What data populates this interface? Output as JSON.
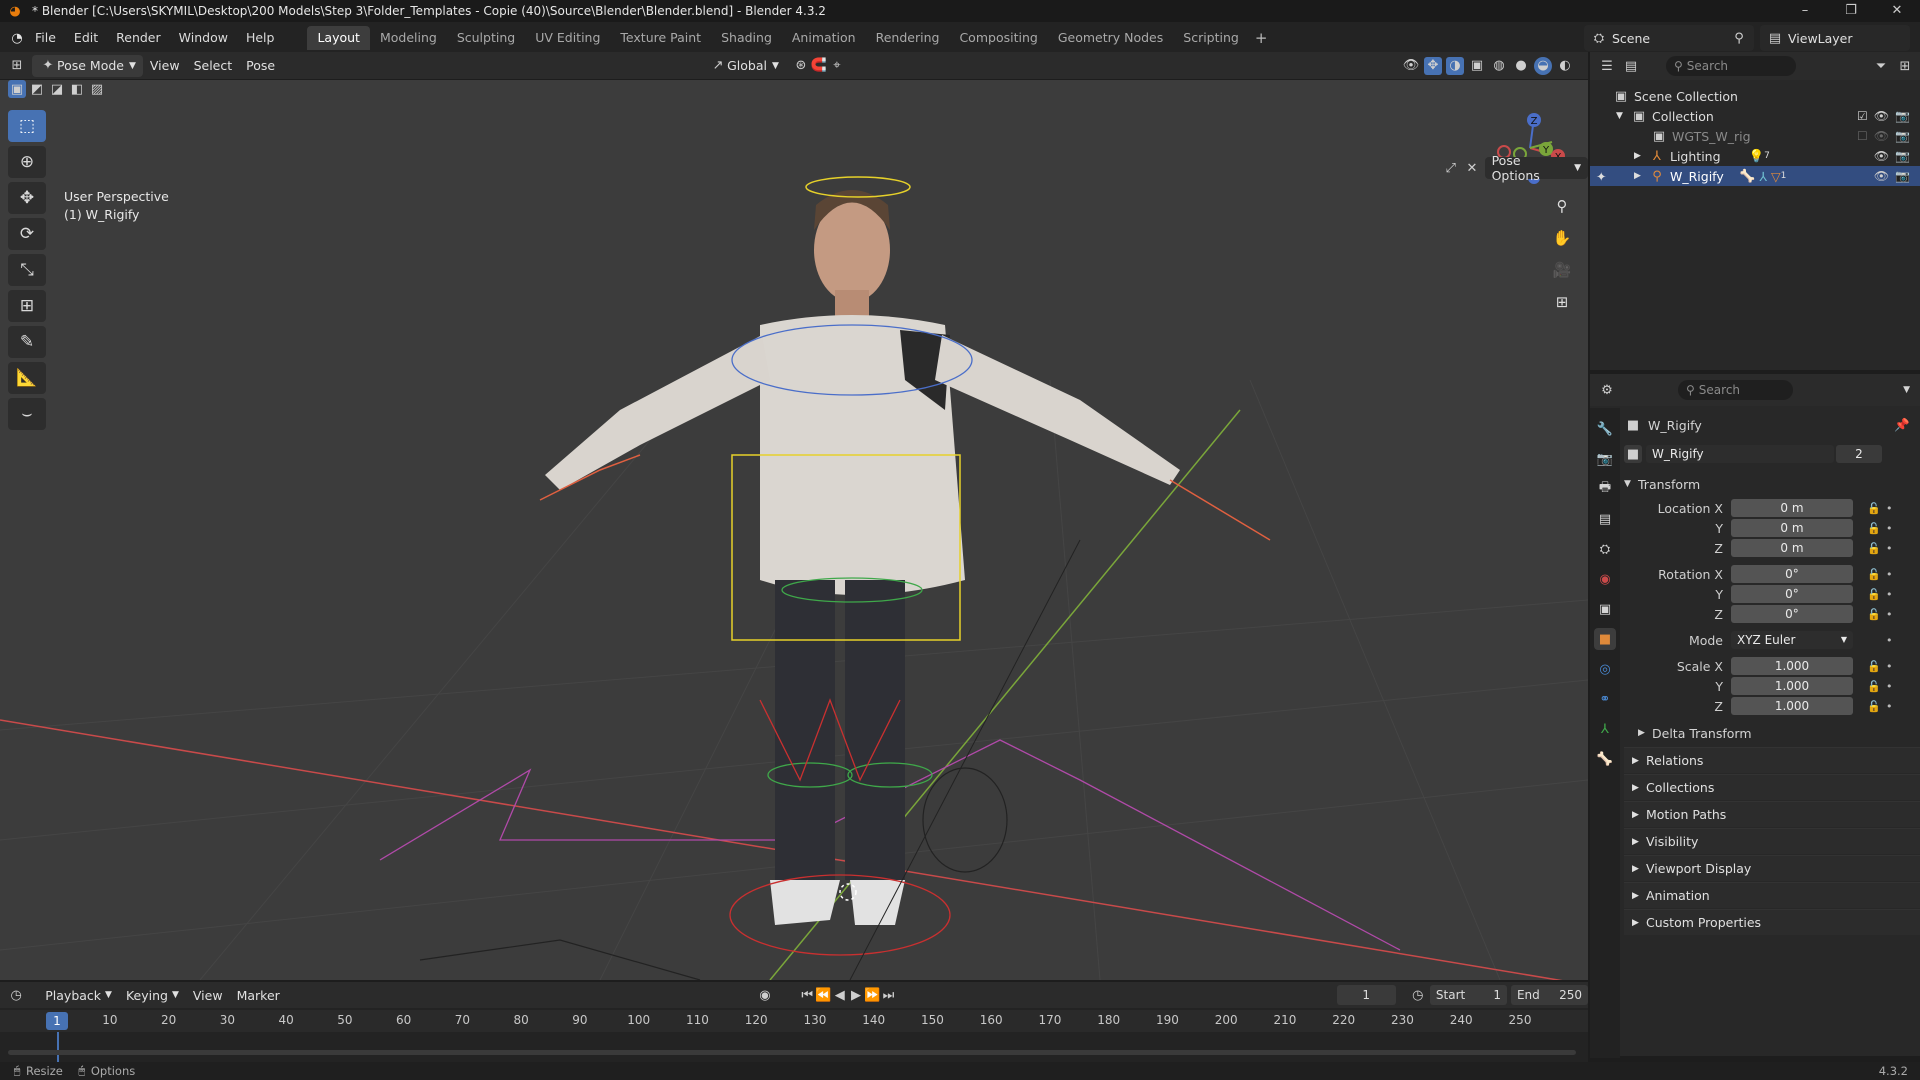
{
  "window": {
    "title": "* Blender [C:\\Users\\SKYMIL\\Desktop\\200 Models\\Step 3\\Folder_Templates - Copie (40)\\Source\\Blender\\Blender.blend] - Blender 4.3.2",
    "minimize": "–",
    "maximize": "❐",
    "close": "✕"
  },
  "menu": [
    "File",
    "Edit",
    "Render",
    "Window",
    "Help"
  ],
  "workspaces": [
    "Layout",
    "Modeling",
    "Sculpting",
    "UV Editing",
    "Texture Paint",
    "Shading",
    "Animation",
    "Rendering",
    "Compositing",
    "Geometry Nodes",
    "Scripting"
  ],
  "active_workspace": "Layout",
  "scene_name": "Scene",
  "view_layer": "ViewLayer",
  "viewport_header": {
    "mode": "Pose Mode",
    "menus": [
      "View",
      "Select",
      "Pose"
    ],
    "orientation": "Global",
    "pose_options": "Pose Options"
  },
  "viewport": {
    "perspective_label": "User Perspective",
    "object_label": "(1) W_Rigify",
    "gizmo": {
      "x": "X",
      "y": "Y",
      "z": "Z"
    },
    "colors": {
      "x_axis": "#c94a4a",
      "y_axis": "#7aa63a",
      "bone_yellow": "#e6d12a",
      "bone_red": "#c93030",
      "bone_green": "#3fa84a",
      "widget_magenta": "#b04aa8"
    }
  },
  "outliner": {
    "search_placeholder": "Search",
    "root": "Scene Collection",
    "items": [
      {
        "label": "Collection"
      },
      {
        "label": "WGTS_W_rig"
      },
      {
        "label": "Lighting",
        "badge": "7"
      },
      {
        "label": "W_Rigify",
        "badge": "1"
      }
    ]
  },
  "properties": {
    "search_placeholder": "Search",
    "object_name": "W_Rigify",
    "data_name": "W_Rigify",
    "users": "2",
    "transform_header": "Transform",
    "location": {
      "label_x": "Location X",
      "x": "0 m",
      "y": "0 m",
      "z": "0 m"
    },
    "rotation": {
      "label_x": "Rotation X",
      "x": "0°",
      "y": "0°",
      "z": "0°"
    },
    "mode": {
      "label": "Mode",
      "value": "XYZ Euler"
    },
    "scale": {
      "label_x": "Scale X",
      "x": "1.000",
      "y": "1.000",
      "z": "1.000"
    },
    "axis_y": "Y",
    "axis_z": "Z",
    "delta": "Delta Transform",
    "panels": [
      "Relations",
      "Collections",
      "Motion Paths",
      "Visibility",
      "Viewport Display",
      "Animation",
      "Custom Properties"
    ]
  },
  "timeline": {
    "menus": [
      "Playback",
      "Keying",
      "View",
      "Marker"
    ],
    "current_frame": "1",
    "start_label": "Start",
    "start": "1",
    "end_label": "End",
    "end": "250",
    "ticks": [
      "1",
      "10",
      "20",
      "30",
      "40",
      "50",
      "60",
      "70",
      "80",
      "90",
      "100",
      "110",
      "120",
      "130",
      "140",
      "150",
      "160",
      "170",
      "180",
      "190",
      "200",
      "210",
      "220",
      "230",
      "240",
      "250"
    ]
  },
  "status_bar": {
    "left1": "Resize",
    "left2": "Options",
    "version": "4.3.2"
  }
}
